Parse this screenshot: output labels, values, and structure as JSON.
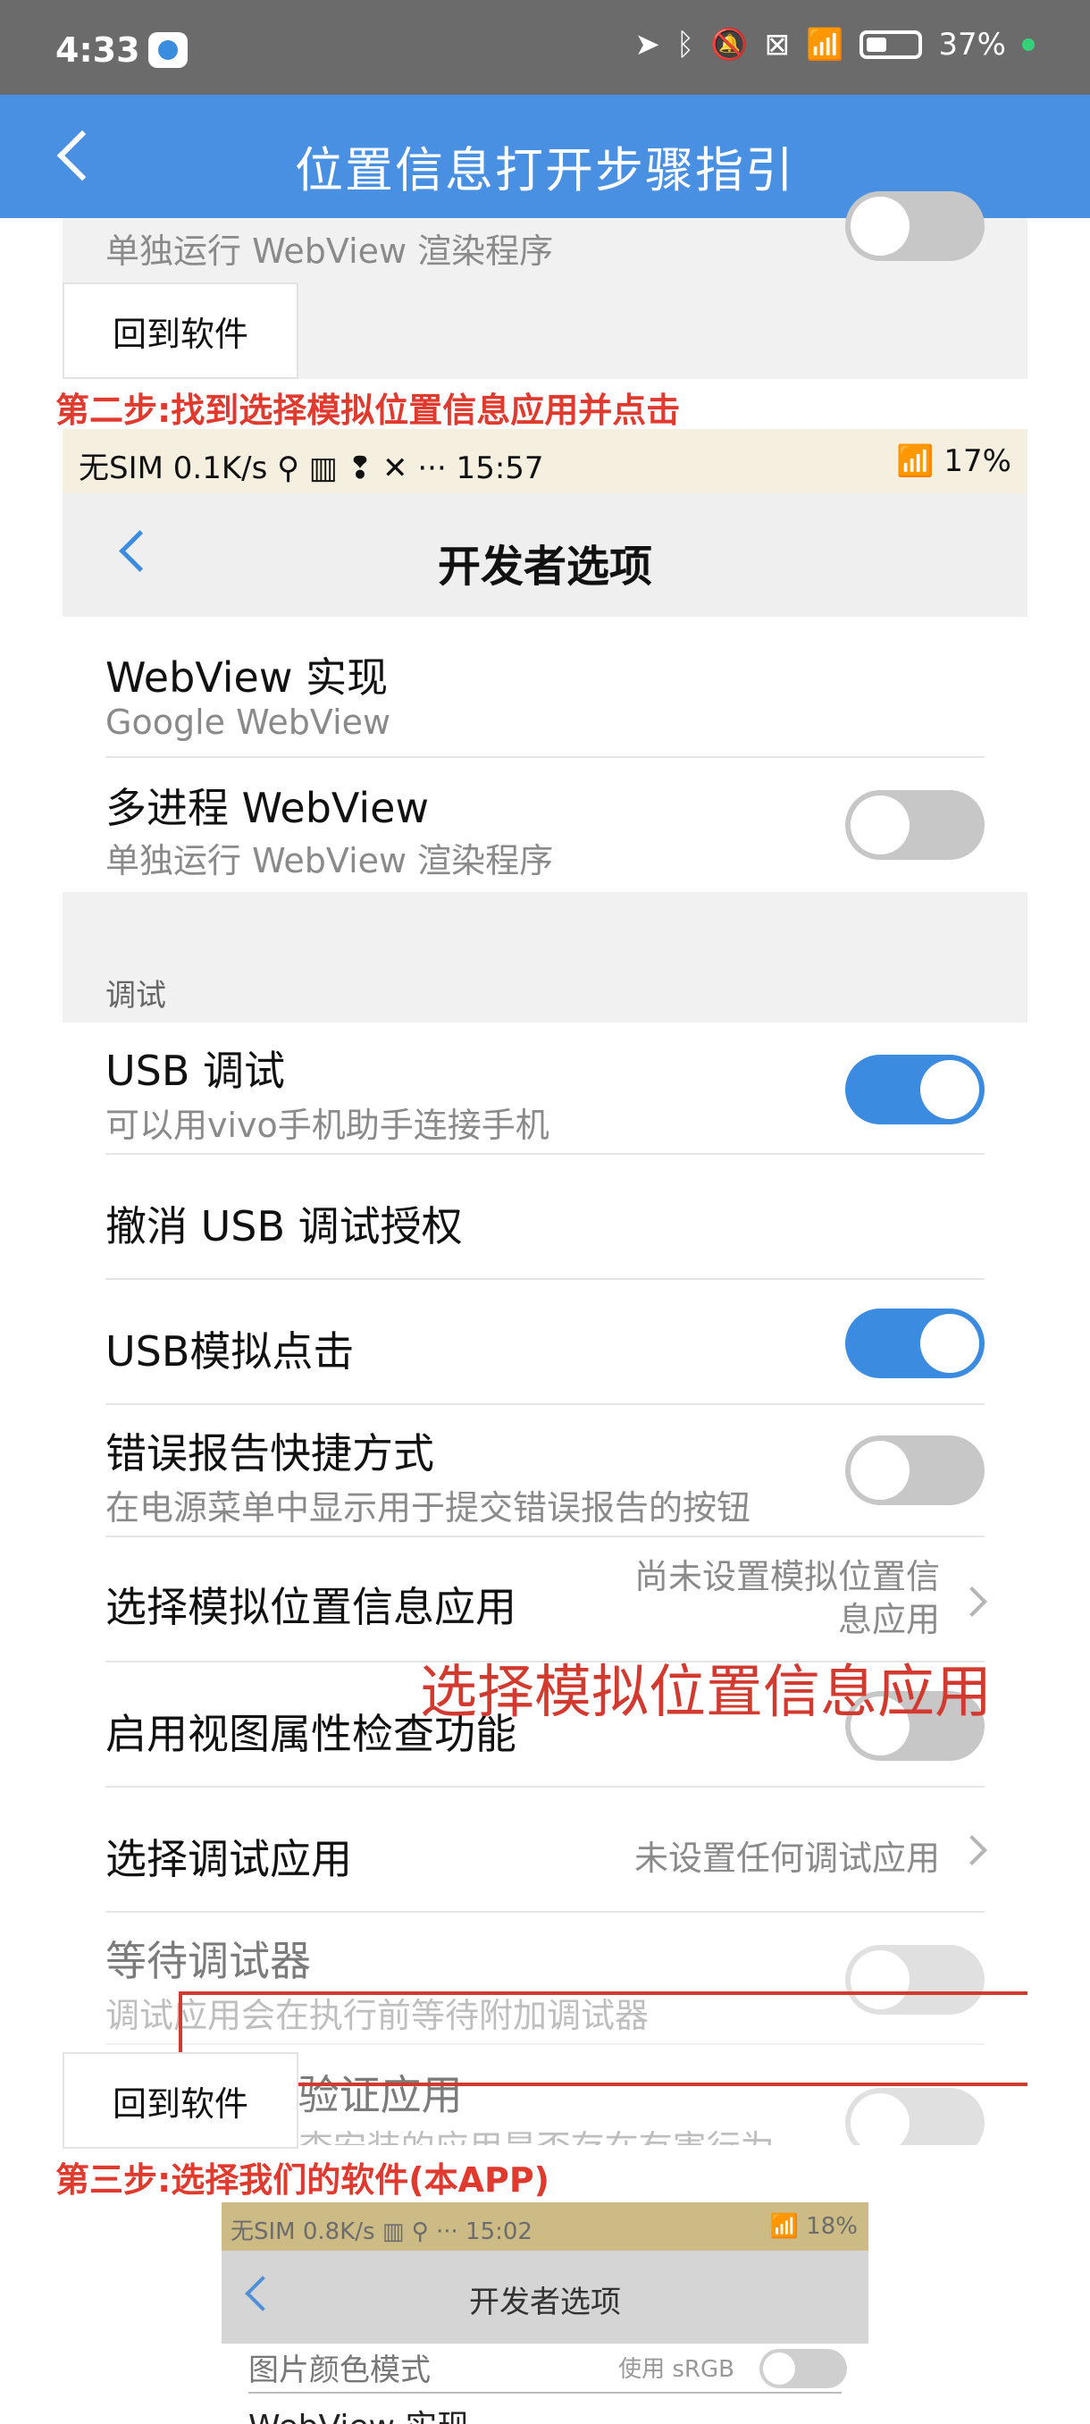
{
  "status_bar": {
    "time": "4:33",
    "battery_percent": "37%",
    "icons": [
      "location-arrow-icon",
      "bluetooth-icon",
      "mute-bell-icon",
      "no-sim-icon",
      "wifi-icon",
      "battery-icon",
      "status-dot-icon"
    ]
  },
  "header": {
    "title": "位置信息打开步骤指引"
  },
  "top_partial_row": {
    "subtitle": "单独运行 WebView 渲染程序"
  },
  "buttons": {
    "back_to_app": "回到软件"
  },
  "steps": {
    "step2": "第二步:找到选择模拟位置信息应用并点击",
    "step3": "第三步:选择我们的软件(本APP)"
  },
  "embedded1": {
    "status_left": "无SIM 0.1K/s  ⚲  ▥  ❢  ✕  ···  15:57",
    "status_right": "17%",
    "title": "开发者选项",
    "section_debug": "调试",
    "rows": [
      {
        "title": "WebView 实现",
        "subtitle": "Google WebView"
      },
      {
        "title": "多进程 WebView",
        "subtitle": "单独运行 WebView 渲染程序",
        "toggle": "off"
      },
      {
        "title": "USB 调试",
        "subtitle": "可以用vivo手机助手连接手机",
        "toggle": "on"
      },
      {
        "title": "撤消 USB 调试授权"
      },
      {
        "title": "USB模拟点击",
        "toggle": "on"
      },
      {
        "title": "错误报告快捷方式",
        "subtitle": "在电源菜单中显示用于提交错误报告的按钮",
        "toggle": "off"
      },
      {
        "title": "选择模拟位置信息应用",
        "value": "尚未设置模拟位置信\n息应用"
      },
      {
        "title": "启用视图属性检查功能",
        "toggle": "off"
      },
      {
        "title": "选择调试应用",
        "value": "未设置任何调试应用"
      },
      {
        "title": "等待调试器",
        "subtitle": "调试应用会在执行前等待附加调试器",
        "toggle": "off"
      },
      {
        "title": "通过 USB 验证应用",
        "subtitle": "通过 ADT 检查安装的应用是否存在有害行为",
        "toggle": "off"
      }
    ],
    "highlight_label": "选择模拟位置信息应用"
  },
  "embedded2": {
    "status_left": "无SIM 0.8K/s  ▥  ⚲  ···  15:02",
    "status_right": "18%",
    "title": "开发者选项",
    "row1_title": "图片颜色模式",
    "row1_value": "使用 sRGB",
    "row2_title": "WebView 实现"
  }
}
